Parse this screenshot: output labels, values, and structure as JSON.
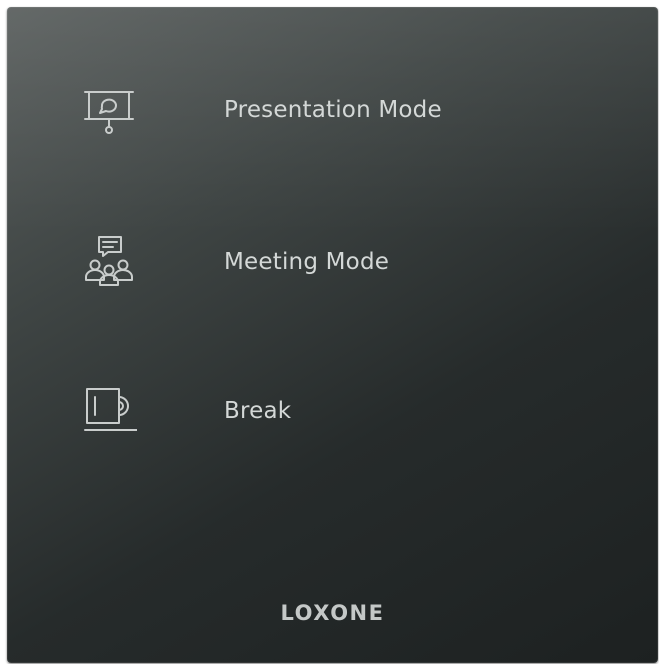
{
  "items": [
    {
      "label": "Presentation Mode",
      "icon": "presentation-board-icon"
    },
    {
      "label": "Meeting Mode",
      "icon": "meeting-group-icon"
    },
    {
      "label": "Break",
      "icon": "coffee-mug-icon"
    }
  ],
  "brand": "LOXONE",
  "colors": {
    "panel_top": "#5b605f",
    "panel_bottom": "#1d2121",
    "text": "#d4d8d7",
    "icon": "#c9cdcc"
  }
}
